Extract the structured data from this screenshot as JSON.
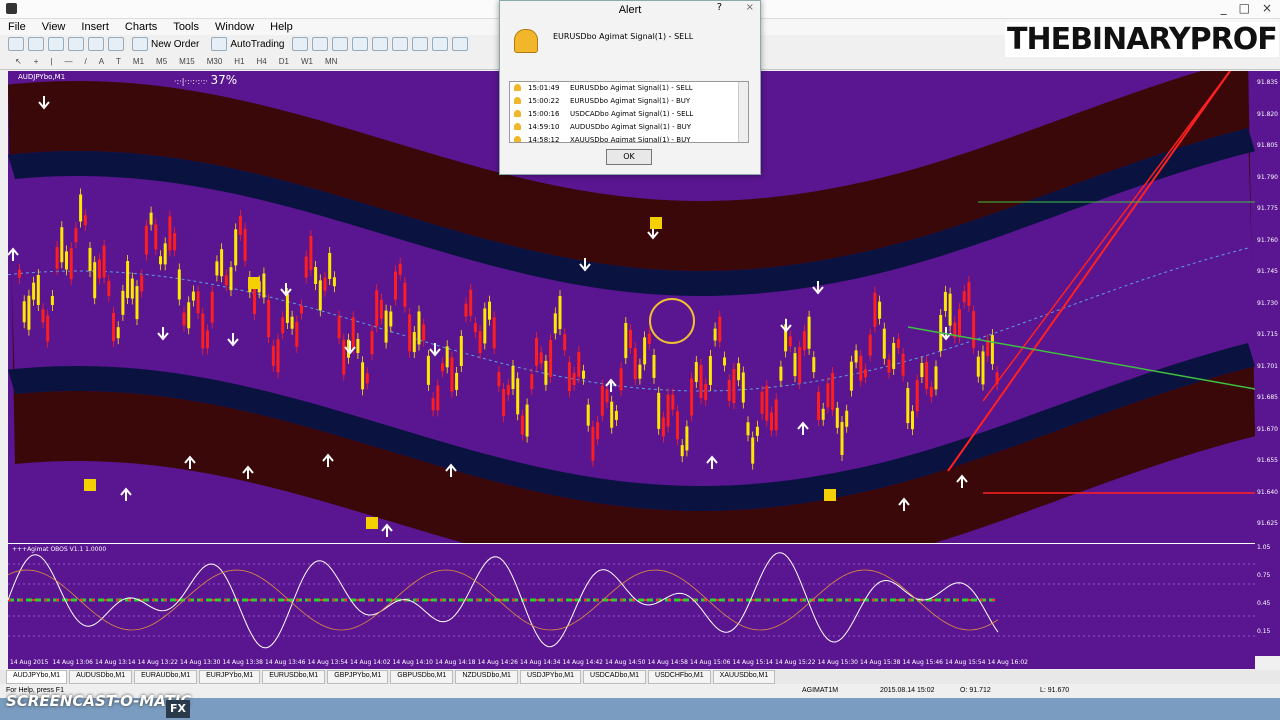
{
  "window": {
    "controls": [
      "_",
      "□",
      "×"
    ]
  },
  "menu": [
    "File",
    "View",
    "Insert",
    "Charts",
    "Tools",
    "Window",
    "Help"
  ],
  "toolbar": {
    "new_order": "New Order",
    "autotrading": "AutoTrading"
  },
  "timeframes": [
    "M1",
    "M5",
    "M15",
    "M30",
    "H1",
    "H4",
    "D1",
    "W1",
    "MN"
  ],
  "logo": "THEBINARYPROF",
  "chart": {
    "symbol_label": "AUDJPYbo,M1",
    "progress": "37%",
    "price_levels": [
      "91.835",
      "91.820",
      "91.805",
      "91.790",
      "91.775",
      "91.760",
      "91.745",
      "91.730",
      "91.715",
      "91.701",
      "91.685",
      "91.670",
      "91.655",
      "91.640",
      "91.625"
    ],
    "osc_label": "+++Agimat OBOS V1.1 1.0000",
    "osc_levels": [
      "1.05",
      "0.75",
      "0.45",
      "0.15"
    ],
    "time_labels": [
      "14 Aug 2015",
      "14 Aug 13:06",
      "14 Aug 13:14",
      "14 Aug 13:22",
      "14 Aug 13:30",
      "14 Aug 13:38",
      "14 Aug 13:46",
      "14 Aug 13:54",
      "14 Aug 14:02",
      "14 Aug 14:10",
      "14 Aug 14:18",
      "14 Aug 14:26",
      "14 Aug 14:34",
      "14 Aug 14:42",
      "14 Aug 14:50",
      "14 Aug 14:58",
      "14 Aug 15:06",
      "14 Aug 15:14",
      "14 Aug 15:22",
      "14 Aug 15:30",
      "14 Aug 15:38",
      "14 Aug 15:46",
      "14 Aug 15:54",
      "14 Aug 16:02"
    ],
    "colors": {
      "background": "#5a1590",
      "bull": "#ffe800",
      "bear": "#ff1e1e",
      "band": "#3a0808",
      "channel": "#0a1340",
      "trend": "#ff2020",
      "line": "#40c040"
    }
  },
  "alert": {
    "title": "Alert",
    "help": "?",
    "close": "×",
    "message": "EURUSDbo Agimat Signal(1) - SELL",
    "rows": [
      {
        "time": "15:01:49",
        "msg": "EURUSDbo Agimat Signal(1) - SELL"
      },
      {
        "time": "15:00:22",
        "msg": "EURUSDbo Agimat Signal(1) - BUY"
      },
      {
        "time": "15:00:16",
        "msg": "USDCADbo Agimat Signal(1) - SELL"
      },
      {
        "time": "14:59:10",
        "msg": "AUDUSDbo Agimat Signal(1) - BUY"
      },
      {
        "time": "14:58:12",
        "msg": "XAUUSDbo Agimat Signal(1) - BUY"
      }
    ],
    "ok": "OK"
  },
  "tabs": [
    "AUDJPYbo,M1",
    "AUDUSDbo,M1",
    "EURAUDbo,M1",
    "EURJPYbo,M1",
    "EURUSDbo,M1",
    "GBPJPYbo,M1",
    "GBPUSDbo,M1",
    "NZDUSDbo,M1",
    "USDJPYbo,M1",
    "USDCADbo,M1",
    "USDCHFbo,M1",
    "XAUUSDbo,M1"
  ],
  "status": {
    "help": "For Help, press F1",
    "profile": "AGIMAT1M",
    "datetime": "2015.08.14 15:02",
    "open": "O: 91.712",
    "low": "L: 91.670"
  },
  "watermark": "SCREENCAST-O-MATIC",
  "fx_icon": "FX"
}
